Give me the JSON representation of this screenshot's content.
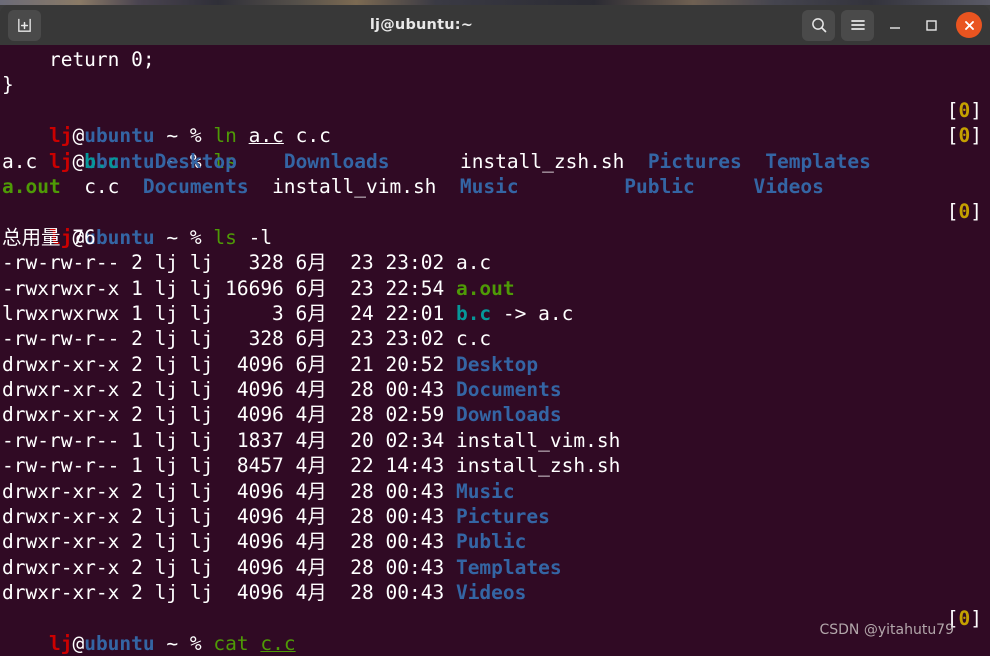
{
  "window": {
    "title": "lj@ubuntu:~",
    "new_tab_icon": "new-tab-icon",
    "search_icon": "search-icon",
    "menu_icon": "hamburger-menu-icon",
    "minimize_icon": "minimize-icon",
    "maximize_icon": "maximize-icon",
    "close_icon": "close-icon",
    "accent_close_color": "#e95420",
    "titlebar_color": "#383838",
    "terminal_bg_color": "#300a24"
  },
  "prompt": {
    "user": "lj",
    "at": "@",
    "host": "ubuntu",
    "cwd": "~",
    "symbol": "%",
    "exit_code": "[0]"
  },
  "terminal": {
    "lines": [
      {
        "id": "code-return",
        "text": "    return 0;"
      },
      {
        "id": "code-brace",
        "text": "}"
      }
    ],
    "commands": {
      "ln": "ln",
      "ln_arg1": "a.c",
      "ln_arg2": "c.c",
      "ls": "ls",
      "ls_l": "ls",
      "ls_l_flag": "-l",
      "cat": "cat",
      "cat_arg": "c.c"
    },
    "ls_output": {
      "row1": [
        "a.c",
        "b.c",
        "Desktop",
        "Downloads",
        "install_zsh.sh",
        "Pictures",
        "Templates"
      ],
      "row2": [
        "a.out",
        "c.c",
        "Documents",
        "install_vim.sh",
        "Music",
        "Public",
        "Videos"
      ]
    },
    "ls_long": {
      "total_label": "总用量",
      "total_value": "76",
      "rows": [
        {
          "perms": "-rw-rw-r--",
          "links": "2",
          "owner": "lj",
          "group": "lj",
          "size": "328",
          "month": "6月",
          "day": "23",
          "time": "23:02",
          "name": "a.c",
          "type": "file",
          "link_target": ""
        },
        {
          "perms": "-rwxrwxr-x",
          "links": "1",
          "owner": "lj",
          "group": "lj",
          "size": "16696",
          "month": "6月",
          "day": "23",
          "time": "22:54",
          "name": "a.out",
          "type": "exe",
          "link_target": ""
        },
        {
          "perms": "lrwxrwxrwx",
          "links": "1",
          "owner": "lj",
          "group": "lj",
          "size": "3",
          "month": "6月",
          "day": "24",
          "time": "22:01",
          "name": "b.c",
          "type": "link",
          "link_target": "-> a.c"
        },
        {
          "perms": "-rw-rw-r--",
          "links": "2",
          "owner": "lj",
          "group": "lj",
          "size": "328",
          "month": "6月",
          "day": "23",
          "time": "23:02",
          "name": "c.c",
          "type": "file",
          "link_target": ""
        },
        {
          "perms": "drwxr-xr-x",
          "links": "2",
          "owner": "lj",
          "group": "lj",
          "size": "4096",
          "month": "6月",
          "day": "21",
          "time": "20:52",
          "name": "Desktop",
          "type": "dir",
          "link_target": ""
        },
        {
          "perms": "drwxr-xr-x",
          "links": "2",
          "owner": "lj",
          "group": "lj",
          "size": "4096",
          "month": "4月",
          "day": "28",
          "time": "00:43",
          "name": "Documents",
          "type": "dir",
          "link_target": ""
        },
        {
          "perms": "drwxr-xr-x",
          "links": "2",
          "owner": "lj",
          "group": "lj",
          "size": "4096",
          "month": "4月",
          "day": "28",
          "time": "02:59",
          "name": "Downloads",
          "type": "dir",
          "link_target": ""
        },
        {
          "perms": "-rw-rw-r--",
          "links": "1",
          "owner": "lj",
          "group": "lj",
          "size": "1837",
          "month": "4月",
          "day": "20",
          "time": "02:34",
          "name": "install_vim.sh",
          "type": "file",
          "link_target": ""
        },
        {
          "perms": "-rw-rw-r--",
          "links": "1",
          "owner": "lj",
          "group": "lj",
          "size": "8457",
          "month": "4月",
          "day": "22",
          "time": "14:43",
          "name": "install_zsh.sh",
          "type": "file",
          "link_target": ""
        },
        {
          "perms": "drwxr-xr-x",
          "links": "2",
          "owner": "lj",
          "group": "lj",
          "size": "4096",
          "month": "4月",
          "day": "28",
          "time": "00:43",
          "name": "Music",
          "type": "dir",
          "link_target": ""
        },
        {
          "perms": "drwxr-xr-x",
          "links": "2",
          "owner": "lj",
          "group": "lj",
          "size": "4096",
          "month": "4月",
          "day": "28",
          "time": "00:43",
          "name": "Pictures",
          "type": "dir",
          "link_target": ""
        },
        {
          "perms": "drwxr-xr-x",
          "links": "2",
          "owner": "lj",
          "group": "lj",
          "size": "4096",
          "month": "4月",
          "day": "28",
          "time": "00:43",
          "name": "Public",
          "type": "dir",
          "link_target": ""
        },
        {
          "perms": "drwxr-xr-x",
          "links": "2",
          "owner": "lj",
          "group": "lj",
          "size": "4096",
          "month": "4月",
          "day": "28",
          "time": "00:43",
          "name": "Templates",
          "type": "dir",
          "link_target": ""
        },
        {
          "perms": "drwxr-xr-x",
          "links": "2",
          "owner": "lj",
          "group": "lj",
          "size": "4096",
          "month": "4月",
          "day": "28",
          "time": "00:43",
          "name": "Videos",
          "type": "dir",
          "link_target": ""
        }
      ]
    }
  },
  "watermark": {
    "text": "CSDN @yitahutu79"
  }
}
